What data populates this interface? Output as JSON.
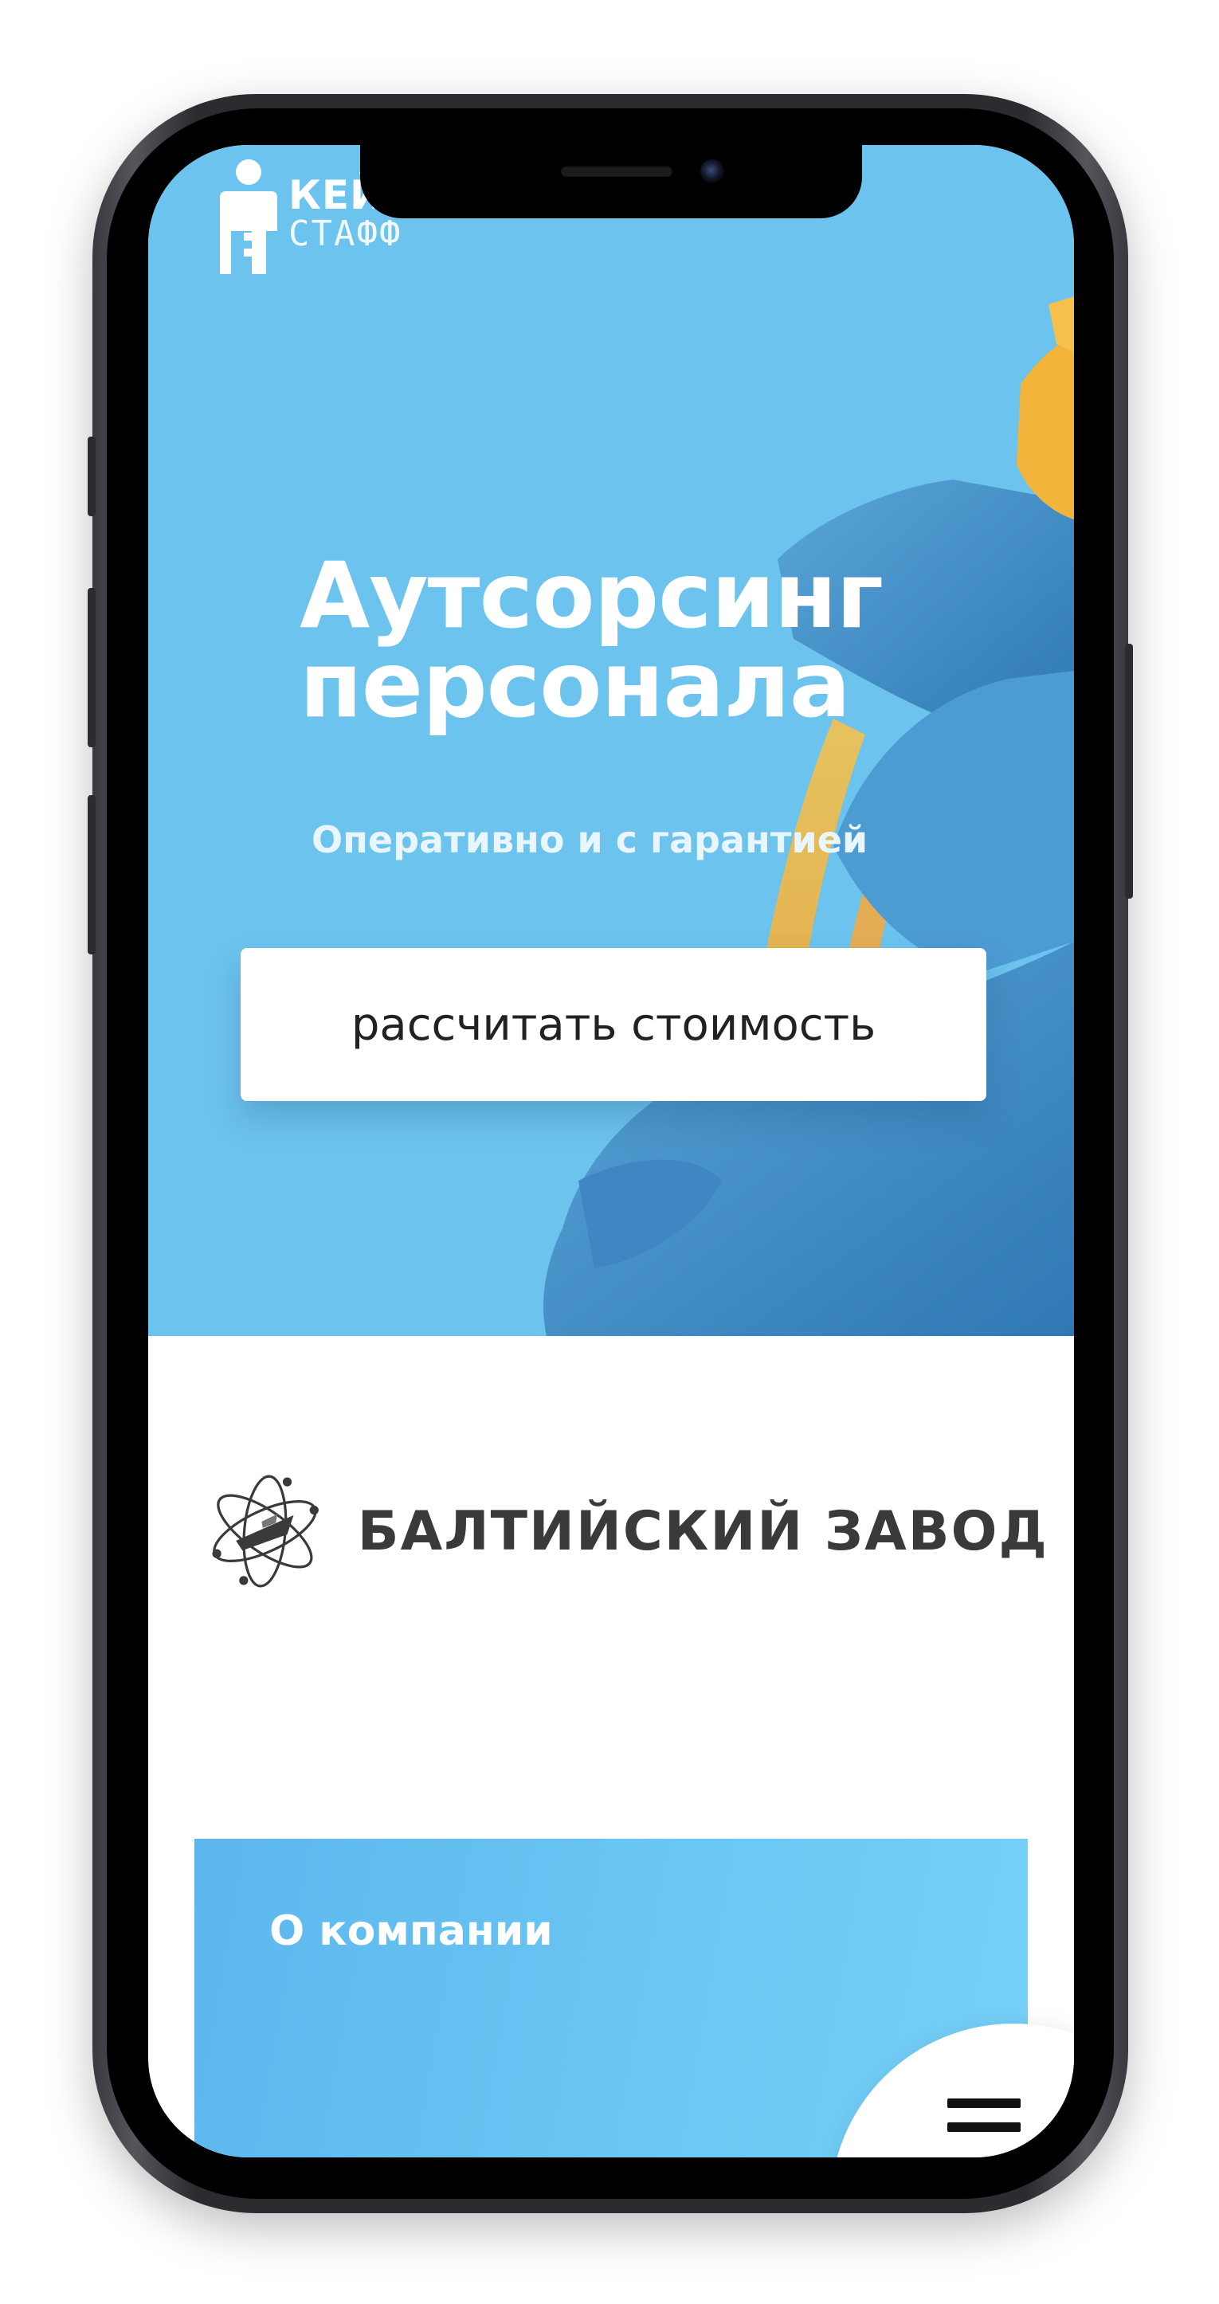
{
  "header": {
    "logo_title": "КЕЙ",
    "logo_subtitle": "СТАФФ"
  },
  "hero": {
    "title_line1": "Аутсорсинг",
    "title_line2": "персонала",
    "subtitle": "Оперативно и с гарантией",
    "cta_label": "рассчитать стоимость"
  },
  "clients": {
    "current_name": "БАЛТИЙСКИЙ ЗАВОД"
  },
  "about": {
    "title": "О компании"
  },
  "menu": {
    "icon": "hamburger-menu-icon"
  },
  "colors": {
    "hero_bg": "#6cc3ee",
    "accent": "#5db7ee",
    "button_bg": "#ffffff",
    "frame": "#2c2b30"
  }
}
